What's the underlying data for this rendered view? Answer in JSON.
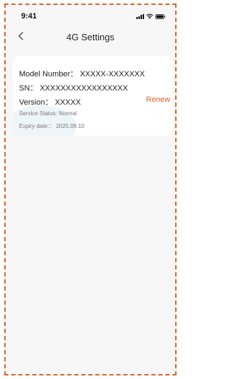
{
  "status_bar": {
    "time": "9:41"
  },
  "nav": {
    "title": "4G Settings"
  },
  "card": {
    "model": "Model Number： XXXXX-XXXXXXX",
    "sn": "SN： XXXXXXXXXXXXXXXXX",
    "version": "Version： XXXXX",
    "renew": "Renew",
    "service_status": "Service Status: Normal",
    "expiry": "Expiry date:： 2025.09.10"
  },
  "colors": {
    "accent": "#d9632e",
    "background": "#f7f7f8"
  }
}
